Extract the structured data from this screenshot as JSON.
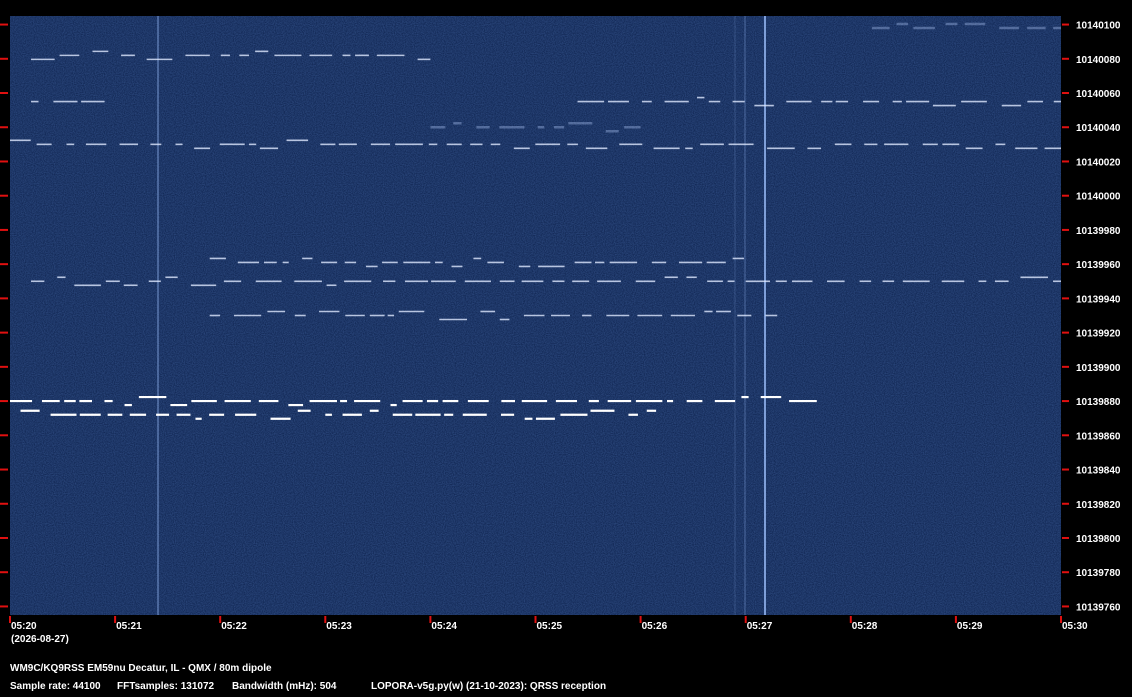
{
  "chart_data": {
    "type": "heatmap",
    "title": "",
    "xlabel": "",
    "ylabel": "",
    "x_ticks": [
      "05:20",
      "05:21",
      "05:22",
      "05:23",
      "05:24",
      "05:25",
      "05:26",
      "05:27",
      "05:28",
      "05:29",
      "05:30"
    ],
    "x_date": "(2026-08-27)",
    "y_ticks": [
      10140100,
      10140080,
      10140060,
      10140040,
      10140020,
      10140000,
      10139980,
      10139960,
      10139940,
      10139920,
      10139900,
      10139880,
      10139860,
      10139840,
      10139820,
      10139800,
      10139780,
      10139760
    ],
    "xlim": [
      "05:20",
      "05:30"
    ],
    "ylim": [
      10139755,
      10140105
    ],
    "colors": {
      "background": "#0b1f4a",
      "tick_mark": "#e01010",
      "signal": "#ffffff"
    },
    "signals": [
      {
        "freq": 10139880,
        "start": "05:20",
        "end": "05:27.7",
        "strength": "strong"
      },
      {
        "freq": 10139872,
        "start": "05:20.1",
        "end": "05:26.2",
        "strength": "strong"
      },
      {
        "freq": 10139961,
        "start": "05:21.9",
        "end": "05:27.1",
        "strength": "medium"
      },
      {
        "freq": 10139950,
        "start": "05:20.2",
        "end": "05:30",
        "strength": "medium"
      },
      {
        "freq": 10139930,
        "start": "05:21.9",
        "end": "05:27.3",
        "strength": "medium"
      },
      {
        "freq": 10140055,
        "start": "05:20.2",
        "end": "05:20.9",
        "strength": "medium"
      },
      {
        "freq": 10140055,
        "start": "05:25.4",
        "end": "05:30",
        "strength": "medium"
      },
      {
        "freq": 10140082,
        "start": "05:20.2",
        "end": "05:24",
        "strength": "medium"
      },
      {
        "freq": 10140030,
        "start": "05:20",
        "end": "05:30",
        "strength": "medium"
      },
      {
        "freq": 10140098,
        "start": "05:28.2",
        "end": "05:30",
        "strength": "weak"
      },
      {
        "freq": 10140040,
        "start": "05:24",
        "end": "05:26",
        "strength": "weak"
      }
    ]
  },
  "footer": {
    "station": "WM9C/KQ9RSS EM59nu Decatur, IL - QMX / 80m dipole",
    "sample_rate": "Sample rate: 44100",
    "fft_samples": "FFTsamples: 131072",
    "bandwidth": "Bandwidth (mHz): 504",
    "software": "LOPORA-v5g.py(w) (21-10-2023): QRSS reception"
  }
}
